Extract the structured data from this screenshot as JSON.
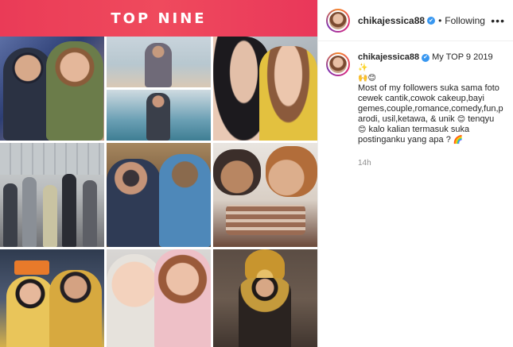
{
  "banner": {
    "title": "TOP NINE"
  },
  "header": {
    "username": "chikajessica88",
    "verified": "✔",
    "separator": "•",
    "follow_status": "Following",
    "more": "•••"
  },
  "caption": {
    "username": "chikajessica88",
    "verified": "✔",
    "title": "My TOP 9 2019",
    "title_emojis": "✨\n🙌😊",
    "body": "Most of my followers suka sama foto cewek cantik,cowok cakeup,bayi gemes,couple,romance,comedy,fun,parodi, usil,ketawa, & unik",
    "tenqyu_emoji": "😊",
    "body_end": "tenqyu",
    "question_emoji": "😊",
    "question": "kalo kalian termasuk suka postinganku yang apa ?",
    "end_emoji": "🌈",
    "time": "14h"
  },
  "grid": {
    "photos": [
      "couple-on-stage",
      "couple-at-beach",
      "two-women-selfie",
      "street-group",
      "table-group",
      "noodle-kiss",
      "couple-in-yellow",
      "baby-selfie",
      "traditional-dress"
    ]
  }
}
